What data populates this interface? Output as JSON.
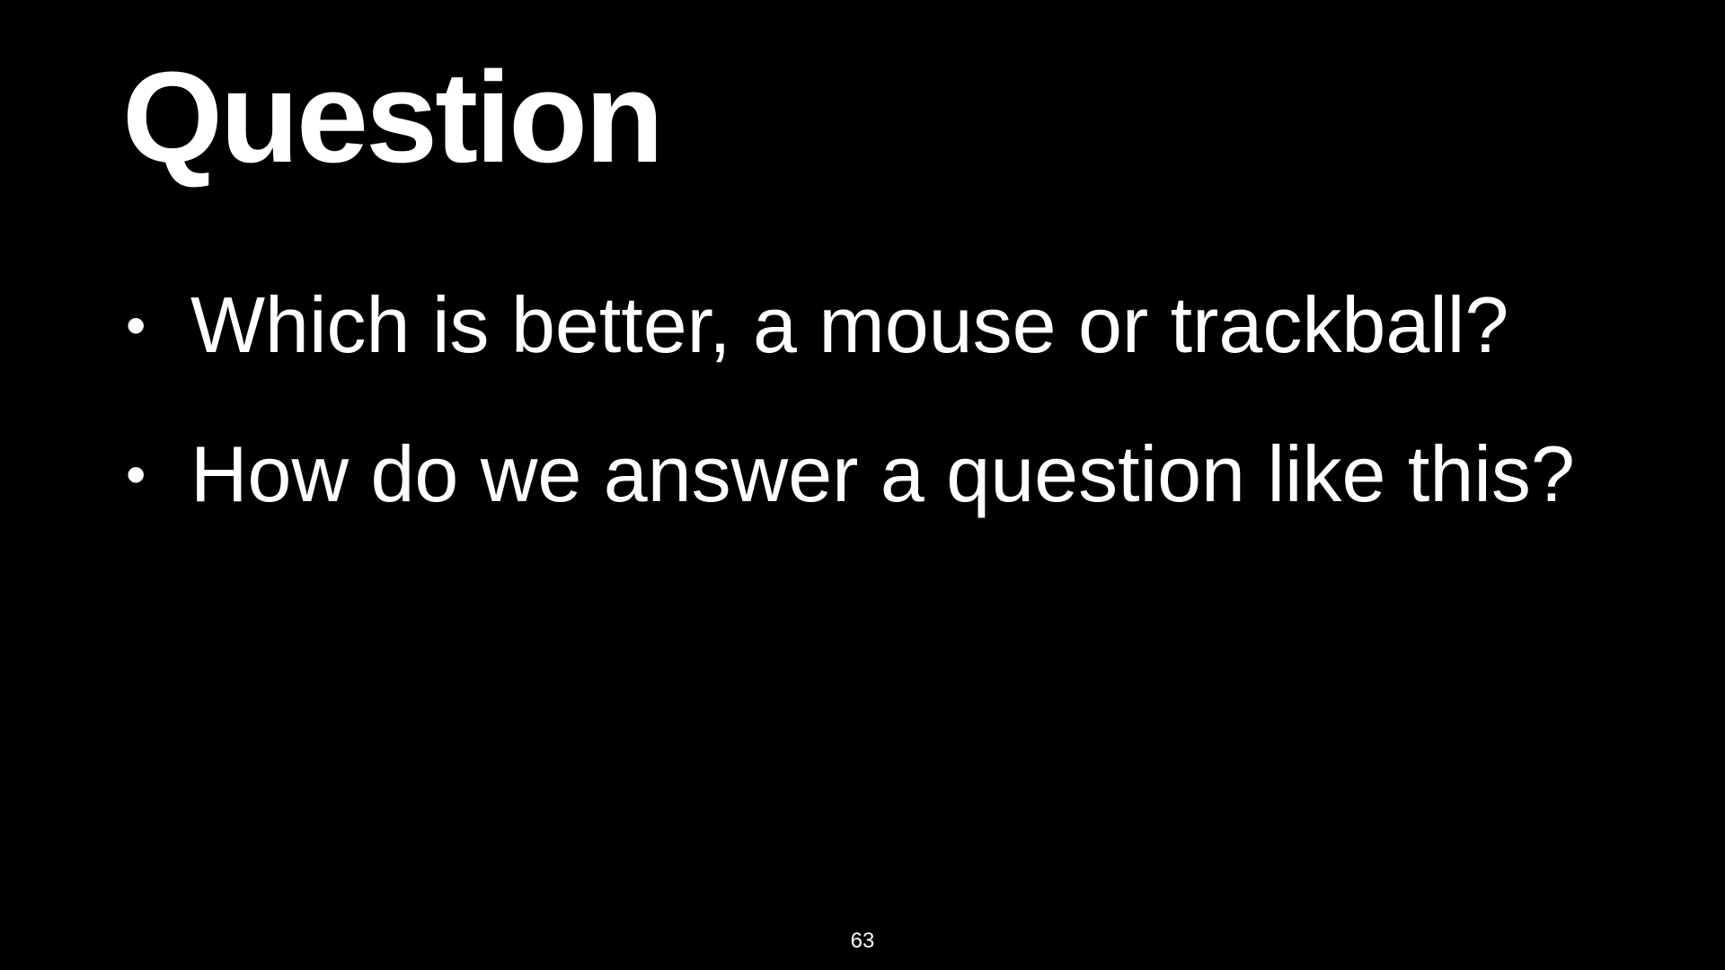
{
  "slide": {
    "title": "Question",
    "bullets": [
      {
        "text": "Which is better, a mouse or trackball?"
      },
      {
        "text": "How do we answer a question like this?"
      }
    ],
    "bullet_glyph": "•",
    "page_number": "63"
  },
  "colors": {
    "background": "#000000",
    "text": "#ffffff"
  }
}
